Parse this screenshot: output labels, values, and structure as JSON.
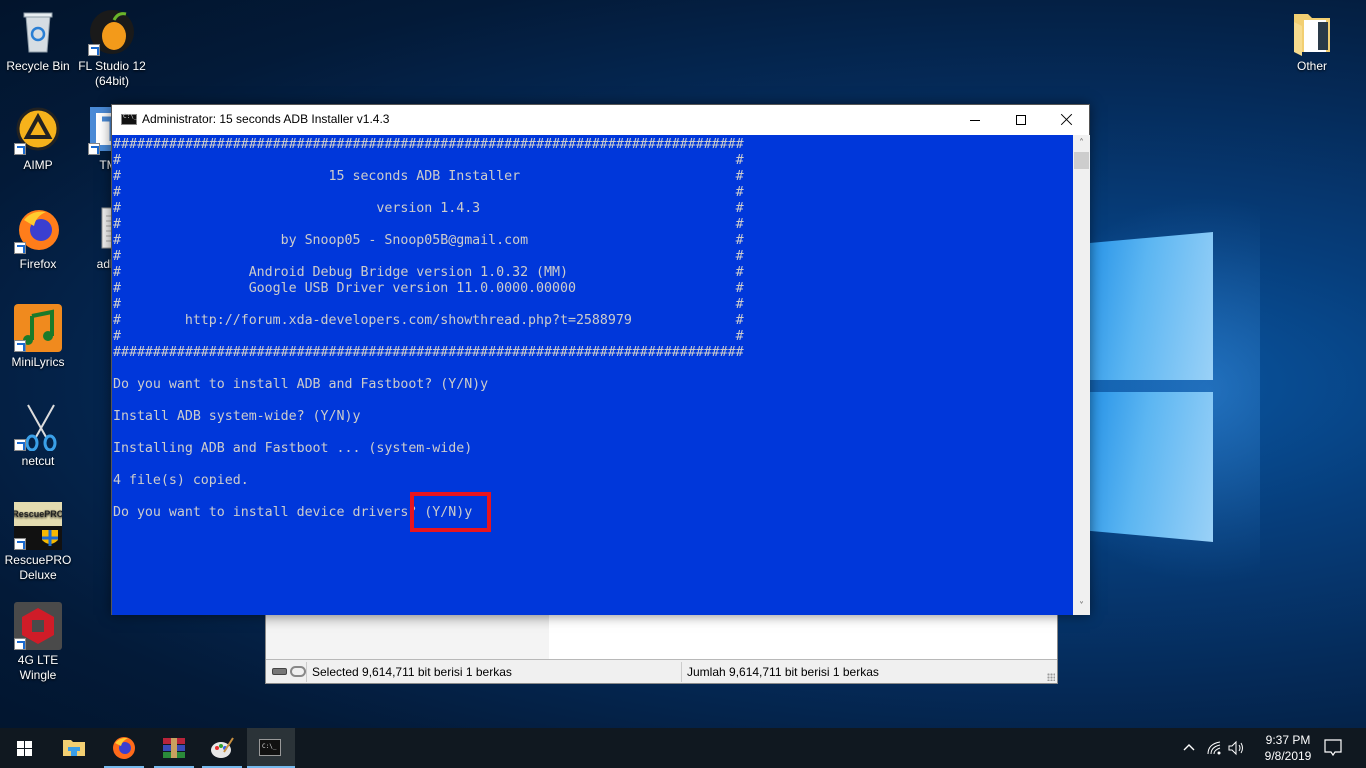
{
  "desktop": {
    "icons_left_col1": [
      {
        "label": "Recycle Bin",
        "icon": "recycle-bin-icon"
      },
      {
        "label": "AIMP",
        "icon": "aimp-icon"
      },
      {
        "label": "Firefox",
        "icon": "firefox-icon"
      },
      {
        "label": "MiniLyrics",
        "icon": "minilyrics-icon"
      },
      {
        "label": "netcut",
        "icon": "scissors-icon"
      },
      {
        "label": "RescuePRO Deluxe",
        "icon": "rescuepro-icon"
      },
      {
        "label": "4G LTE Wingle",
        "icon": "wingle-icon"
      }
    ],
    "icons_left_col2": [
      {
        "label": "FL Studio 12 (64bit)",
        "icon": "fl-studio-icon"
      },
      {
        "label": "TMA",
        "icon": "tma-icon"
      },
      {
        "label": "adb-ir",
        "icon": "text-file-icon"
      }
    ],
    "icons_right": [
      {
        "label": "Other",
        "icon": "folder-icon"
      }
    ]
  },
  "console_window": {
    "title": "Administrator:  15 seconds ADB Installer v1.4.3",
    "lines": [
      "###############################################################################",
      "#                                                                             #",
      "#                          15 seconds ADB Installer                           #",
      "#                                                                             #",
      "#                                version 1.4.3                                #",
      "#                                                                             #",
      "#                    by Snoop05 - Snoop05B@gmail.com                          #",
      "#                                                                             #",
      "#                Android Debug Bridge version 1.0.32 (MM)                     #",
      "#                Google USB Driver version 11.0.0000.00000                    #",
      "#                                                                             #",
      "#        http://forum.xda-developers.com/showthread.php?t=2588979             #",
      "#                                                                             #",
      "###############################################################################",
      "",
      "Do you want to install ADB and Fastboot? (Y/N)y",
      "",
      "Install ADB system-wide? (Y/N)y",
      "",
      "Installing ADB and Fastboot ... (system-wide)",
      "",
      "4 file(s) copied.",
      "",
      "Do you want to install device drivers? (Y/N)y"
    ],
    "background_color": "#0037da",
    "text_color": "#cccccc",
    "highlight_color": "#e8141e",
    "highlighted_text": "(Y/N)y"
  },
  "explorer_window": {
    "status_selected": "Selected 9,614,711 bit berisi 1 berkas",
    "status_total": "Jumlah 9,614,711 bit berisi 1 berkas"
  },
  "taskbar": {
    "apps": [
      {
        "name": "file-explorer",
        "active": false
      },
      {
        "name": "firefox",
        "active": false
      },
      {
        "name": "winrar",
        "active": false
      },
      {
        "name": "paint",
        "active": false
      },
      {
        "name": "command-prompt",
        "active": true
      }
    ],
    "time": "9:37 PM",
    "date": "9/8/2019"
  }
}
